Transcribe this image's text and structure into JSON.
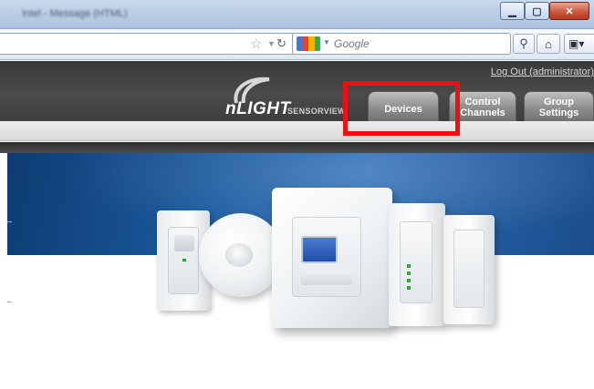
{
  "window": {
    "title": "Intel - Message (HTML)"
  },
  "browser": {
    "search_placeholder": "Google",
    "icons": {
      "bookmark_star": "star-icon",
      "reload": "reload-icon",
      "search_go": "magnifier-icon",
      "home": "home-icon",
      "bookmarks": "bookmarks-icon"
    }
  },
  "site": {
    "logout_text": "Log Out (administrator)",
    "logo": {
      "wordmark": "nLIGHT",
      "sub": "SENSORVIEW"
    },
    "tabs": [
      {
        "label": "Devices"
      },
      {
        "label": "Control Channels"
      },
      {
        "label": "Group Settings"
      }
    ],
    "highlighted_tab": "Devices",
    "highlight_color": "#ee1010"
  }
}
